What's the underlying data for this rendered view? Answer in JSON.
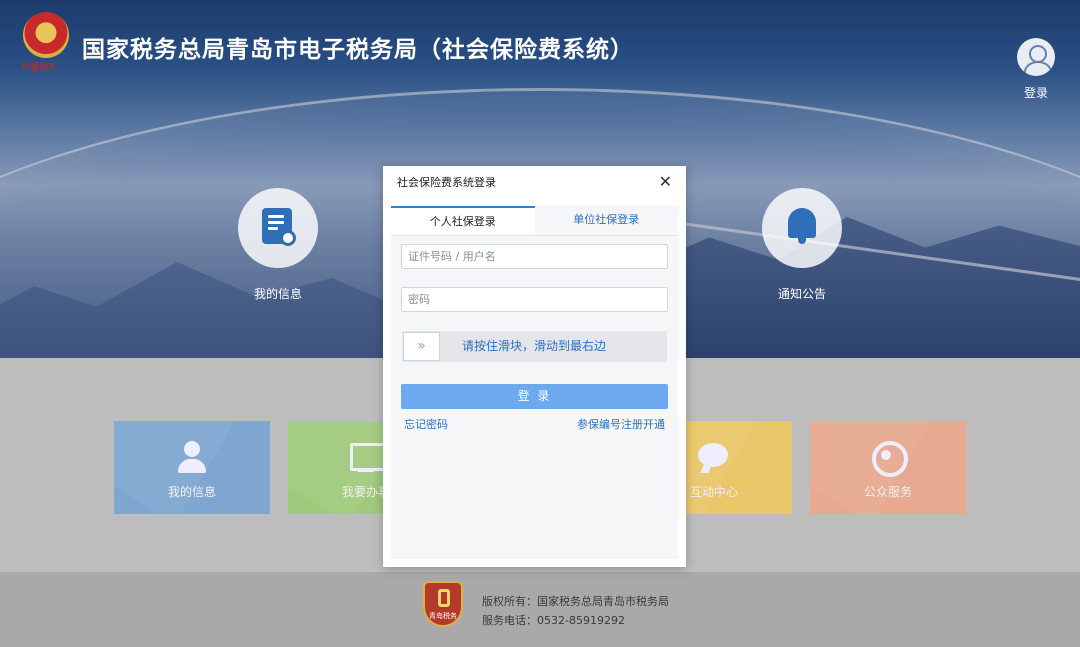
{
  "header": {
    "title": "国家税务总局青岛市电子税务局（社会保险费系统）",
    "emblem_script": "中国税务",
    "login_label": "登录"
  },
  "hero": {
    "left_item": "我的信息",
    "right_item": "通知公告"
  },
  "tiles": [
    {
      "label": "我的信息",
      "color": "#7ea6d1",
      "icon": "person-icon"
    },
    {
      "label": "我要办事",
      "color": "#9fca7c",
      "icon": "monitor-icon"
    },
    {
      "label": "互动中心",
      "color": "#e9c668",
      "icon": "chat-icon"
    },
    {
      "label": "公众服务",
      "color": "#e7a98f",
      "icon": "service-icon"
    }
  ],
  "footer": {
    "copyright": "版权所有：国家税务总局青岛市税务局",
    "phone": "服务电话：0532-85919292",
    "logo_text": "青岛税务"
  },
  "modal": {
    "title": "社会保险费系统登录",
    "close": "✕",
    "tabs": [
      {
        "label": "个人社保登录",
        "active": true
      },
      {
        "label": "单位社保登录",
        "active": false
      }
    ],
    "username_placeholder": "证件号码 / 用户名",
    "password_placeholder": "密码",
    "slider_handle": "»",
    "slider_text": "请按住滑块，滑动到最右边",
    "login_button": "登 录",
    "forgot_password": "忘记密码",
    "register_link": "参保编号注册开通"
  }
}
